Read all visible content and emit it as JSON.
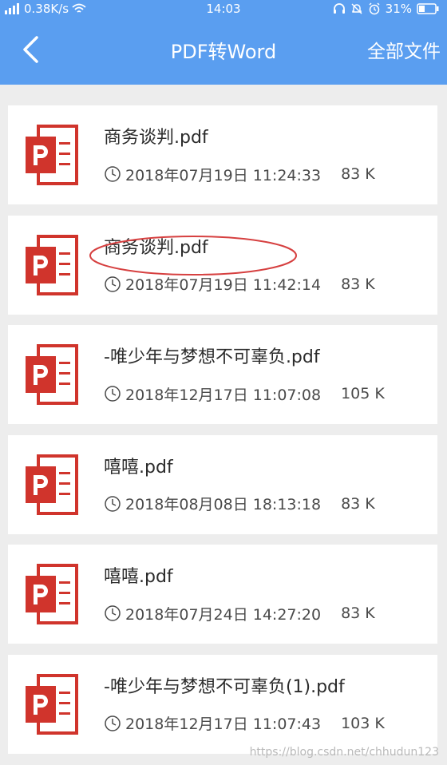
{
  "status_bar": {
    "network_speed": "0.38K/s",
    "time": "14:03",
    "battery": "31%"
  },
  "header": {
    "title": "PDF转Word",
    "right_action": "全部文件",
    "back_icon": "chevron-left-icon"
  },
  "colors": {
    "header_bg": "#5a9ef0",
    "icon_red": "#d0342c",
    "annotation": "#d64040"
  },
  "files": [
    {
      "name": "商务谈判.pdf",
      "date": "2018年07月19日 11:24:33",
      "size": "83 K"
    },
    {
      "name": "商务谈判.pdf",
      "date": "2018年07月19日 11:42:14",
      "size": "83 K"
    },
    {
      "name": "-唯少年与梦想不可辜负.pdf",
      "date": "2018年12月17日 11:07:08",
      "size": "105 K"
    },
    {
      "name": "嘻嘻.pdf",
      "date": "2018年08月08日 18:13:18",
      "size": "83 K"
    },
    {
      "name": "嘻嘻.pdf",
      "date": "2018年07月24日 14:27:20",
      "size": "83 K"
    },
    {
      "name": "-唯少年与梦想不可辜负(1).pdf",
      "date": "2018年12月17日 11:07:43",
      "size": "103 K"
    }
  ],
  "watermark": "https://blog.csdn.net/chhudun123"
}
